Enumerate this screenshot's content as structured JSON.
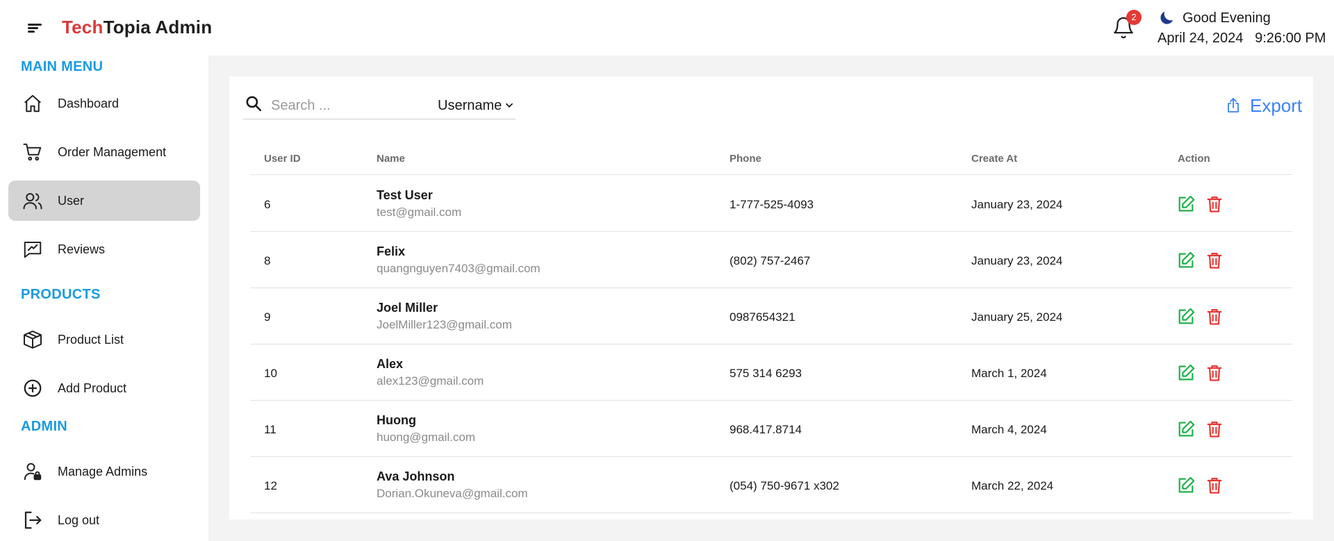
{
  "header": {
    "brand_accent": "Tech",
    "brand_rest": "Topia Admin",
    "notification_count": "2",
    "greeting": "Good Evening",
    "date": "April 24, 2024",
    "time": "9:26:00 PM",
    "colors": {
      "accent": "#d93a3a",
      "badge": "#e53935",
      "moon": "#1e3a8a"
    }
  },
  "sidebar": {
    "sections": [
      {
        "title": "MAIN MENU"
      },
      {
        "title": "PRODUCTS"
      },
      {
        "title": "ADMIN"
      }
    ],
    "items": [
      {
        "label": "Dashboard",
        "icon": "home-icon"
      },
      {
        "label": "Order Management",
        "icon": "cart-icon"
      },
      {
        "label": "User",
        "icon": "users-icon",
        "active": true
      },
      {
        "label": "Reviews",
        "icon": "review-icon"
      },
      {
        "label": "Product List",
        "icon": "box-icon"
      },
      {
        "label": "Add Product",
        "icon": "plus-circle-icon"
      },
      {
        "label": "Manage Admins",
        "icon": "admin-lock-icon"
      },
      {
        "label": "Log out",
        "icon": "logout-icon"
      }
    ],
    "colors": {
      "section_title": "#1a9be0",
      "active_bg": "#d4d4d4"
    }
  },
  "toolbar": {
    "search_placeholder": "Search ...",
    "filter_value": "Username",
    "export_label": "Export",
    "colors": {
      "export": "#3b82f6"
    }
  },
  "table": {
    "columns": [
      "User ID",
      "Name",
      "Phone",
      "Create At",
      "Action"
    ],
    "rows": [
      {
        "id": "6",
        "name": "Test User",
        "email": "test@gmail.com",
        "phone": "1-777-525-4093",
        "created": "January 23, 2024"
      },
      {
        "id": "8",
        "name": "Felix",
        "email": "quangnguyen7403@gmail.com",
        "phone": "(802) 757-2467",
        "created": "January 23, 2024"
      },
      {
        "id": "9",
        "name": "Joel Miller",
        "email": "JoelMiller123@gmail.com",
        "phone": "0987654321",
        "created": "January 25, 2024"
      },
      {
        "id": "10",
        "name": "Alex",
        "email": "alex123@gmail.com",
        "phone": "575 314 6293",
        "created": "March 1, 2024"
      },
      {
        "id": "11",
        "name": "Huong",
        "email": "huong@gmail.com",
        "phone": "968.417.8714",
        "created": "March 4, 2024"
      },
      {
        "id": "12",
        "name": "Ava Johnson",
        "email": "Dorian.Okuneva@gmail.com",
        "phone": "(054) 750-9671 x302",
        "created": "March 22, 2024"
      }
    ],
    "colors": {
      "edit": "#22b14c",
      "delete": "#e53935"
    }
  }
}
